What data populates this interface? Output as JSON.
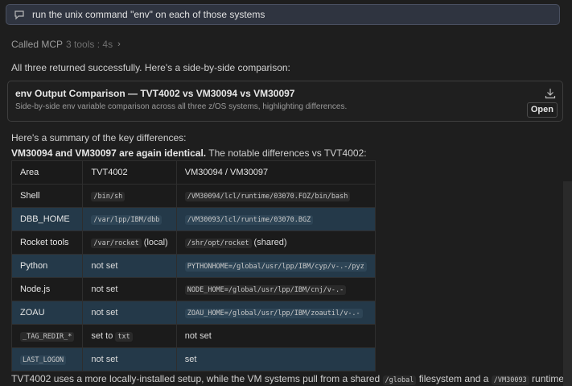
{
  "prompt": {
    "text": "run the unix command \"env\" on each of those systems"
  },
  "called": {
    "label": "Called MCP",
    "detail": "3 tools : 4s"
  },
  "intro": "All three returned successfully. Here's a side-by-side comparison:",
  "card": {
    "title": "env Output Comparison — TVT4002 vs VM30094 vs VM30097",
    "description": "Side-by-side env variable comparison across all three z/OS systems, highlighting differences.",
    "open_label": "Open"
  },
  "summary": "Here's a summary of the key differences:",
  "identical_bold": "VM30094 and VM30097 are again identical.",
  "identical_rest": " The notable differences vs TVT4002:",
  "table": {
    "headers": [
      "Area",
      "TVT4002",
      "VM30094 / VM30097"
    ],
    "rows": [
      {
        "area": "Shell",
        "tvt": "/bin/sh",
        "vm": "/VM30094/lcl/runtime/03070.FOZ/bin/bash"
      },
      {
        "area": "DBB_HOME",
        "tvt": "/var/lpp/IBM/dbb",
        "vm": "/VM30093/lcl/runtime/03070.BGZ"
      },
      {
        "area": "Rocket tools",
        "tvt_code": "/var/rocket",
        "tvt_note": " (local)",
        "vm_code": "/shr/opt/rocket",
        "vm_note": " (shared)"
      },
      {
        "area": "Python",
        "tvt": "not set",
        "vm": "PYTHONHOME=/global/usr/lpp/IBM/cyp/v-.-/pyz"
      },
      {
        "area": "Node.js",
        "tvt": "not set",
        "vm": "NODE_HOME=/global/usr/lpp/IBM/cnj/v-.-"
      },
      {
        "area": "ZOAU",
        "tvt": "not set",
        "vm": "ZOAU_HOME=/global/usr/lpp/IBM/zoautil/v-.-"
      },
      {
        "area": "_TAG_REDIR_*",
        "tvt_pre": "set to ",
        "tvt_code": "txt",
        "vm": "not set"
      },
      {
        "area": "LAST_LOGON",
        "tvt": "not set",
        "vm": "set"
      }
    ]
  },
  "footer": {
    "part1": "TVT4002 uses a more locally-installed setup, while the VM systems pull from a shared ",
    "code1": "/global",
    "part2": " filesystem and a ",
    "code2": "/VM30093",
    "part3": " runtime path."
  },
  "icons": {
    "prompt": "message-icon",
    "download": "download-icon",
    "chevron": "chevron-right-icon"
  }
}
